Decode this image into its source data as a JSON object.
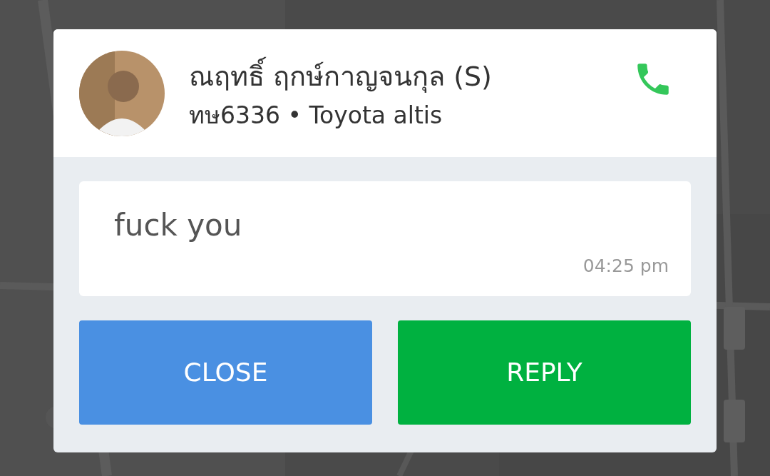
{
  "dialog": {
    "driver": {
      "name": "ณฤทธิ์ ฤกษ์กาญจนกุล (S)",
      "vehicle": "ทษ6336 • Toyota altis"
    },
    "message": {
      "text": "fuck you",
      "time": "04:25 pm"
    },
    "buttons": [
      {
        "label": "CLOSE",
        "color": "#4a90e2"
      },
      {
        "label": "REPLY",
        "color": "#00b140"
      }
    ]
  }
}
